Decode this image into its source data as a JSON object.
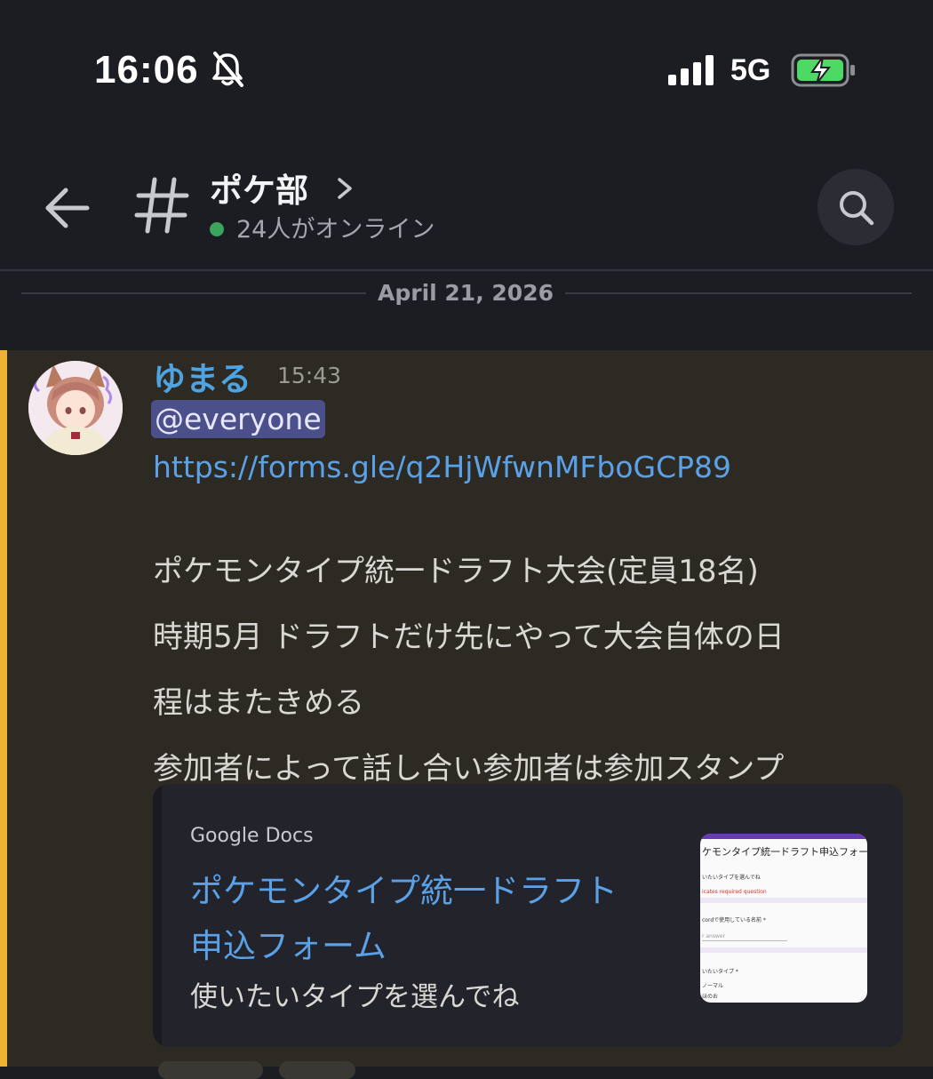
{
  "status_bar": {
    "time": "16:06",
    "network": "5G",
    "colors": {
      "battery_charge": "#4cd964"
    }
  },
  "header": {
    "channel_name": "ポケ部",
    "online_text": "24人がオンライン",
    "colors": {
      "online_dot": "#3ba55d"
    }
  },
  "divider": {
    "date": "April 21, 2026"
  },
  "message": {
    "author": "ゆまる",
    "time": "15:43",
    "mention": "@everyone",
    "link": "https://forms.gle/q2HjWfwnMFboGCP89",
    "lines": [
      "ポケモンタイプ統一ドラフト大会(定員18名)",
      "時期5月 ドラフトだけ先にやって大会自体の日",
      "程はまたきめる",
      "参加者によって話し合い参加者は参加スタンプ"
    ],
    "colors": {
      "accent_bar": "#f0b232",
      "author": "#4fa3e0",
      "link": "#5aa1e8"
    }
  },
  "embed": {
    "provider": "Google Docs",
    "title_lines": [
      "ポケモンタイプ統一ドラフト",
      "申込フォーム"
    ],
    "description": "使いたいタイプを選んでね",
    "thumbnail": {
      "title": "ケモンタイプ統一ドラフト申込フォー",
      "subtitle": "いたいタイプを選んでね",
      "required_note": "icates required question",
      "question1": "cordで使用している名前 *",
      "answer_placeholder": "r answer",
      "question2": "いたいタイプ *",
      "option1": "ノーマル",
      "option2": "ほのお"
    }
  }
}
